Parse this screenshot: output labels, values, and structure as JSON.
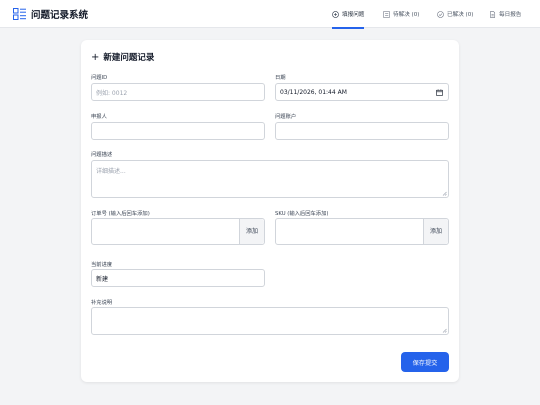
{
  "app": {
    "title": "问题记录系统"
  },
  "nav": {
    "tabs": [
      {
        "label": "填报问题",
        "icon": "plus-circle-icon",
        "active": true
      },
      {
        "label": "待解决 (0)",
        "icon": "list-icon",
        "active": false
      },
      {
        "label": "已解决 (0)",
        "icon": "check-circle-icon",
        "active": false
      },
      {
        "label": "每日报告",
        "icon": "document-icon",
        "active": false
      }
    ]
  },
  "form": {
    "title": "新建问题记录",
    "issue_id": {
      "label": "问题ID",
      "placeholder": "例如: 0012",
      "value": ""
    },
    "date": {
      "label": "日期",
      "value": "03/11/2026, 01:44 AM"
    },
    "reporter": {
      "label": "申报人",
      "value": ""
    },
    "account": {
      "label": "问题账户",
      "value": ""
    },
    "description": {
      "label": "问题描述",
      "placeholder": "详细描述...",
      "value": ""
    },
    "order_no": {
      "label": "订单号 (输入后回车添加)",
      "add_label": "添加",
      "value": ""
    },
    "sku": {
      "label": "SKU (输入后回车添加)",
      "add_label": "添加",
      "value": ""
    },
    "progress": {
      "label": "当前进度",
      "value": "新建"
    },
    "notes": {
      "label": "补充说明",
      "value": ""
    },
    "submit_label": "保存提交"
  },
  "colors": {
    "accent": "#2563eb",
    "background": "#f3f4f6",
    "card": "#ffffff",
    "border": "#d1d5db"
  }
}
